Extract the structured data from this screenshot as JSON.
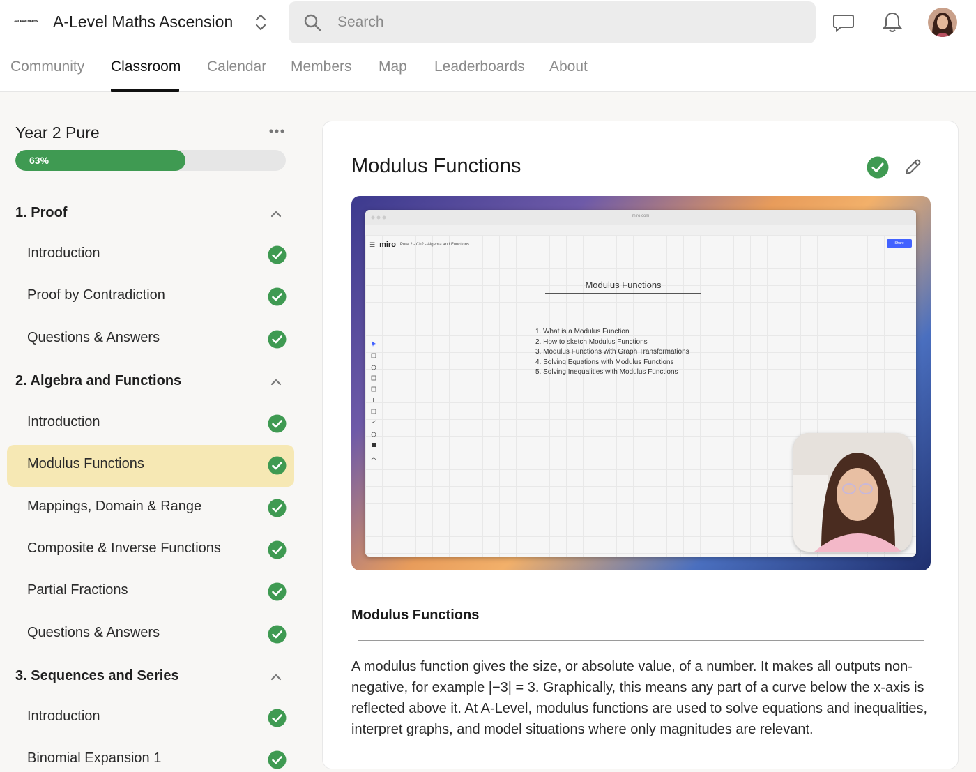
{
  "header": {
    "logo_text": "A-Level Maths",
    "title": "A-Level Maths Ascension",
    "search_placeholder": "Search"
  },
  "tabs": [
    {
      "label": "Community"
    },
    {
      "label": "Classroom"
    },
    {
      "label": "Calendar"
    },
    {
      "label": "Members"
    },
    {
      "label": "Map"
    },
    {
      "label": "Leaderboards"
    },
    {
      "label": "About"
    }
  ],
  "active_tab": "Classroom",
  "sidebar": {
    "course_title": "Year 2 Pure",
    "progress": {
      "value": 0.63,
      "label": "63%"
    },
    "sections": [
      {
        "title": "1. Proof",
        "expanded": true,
        "lessons": [
          {
            "label": "Introduction",
            "completed": true
          },
          {
            "label": "Proof by Contradiction",
            "completed": true
          },
          {
            "label": "Questions & Answers",
            "completed": true
          }
        ]
      },
      {
        "title": "2. Algebra and Functions",
        "expanded": true,
        "lessons": [
          {
            "label": "Introduction",
            "completed": true
          },
          {
            "label": "Modulus Functions",
            "completed": true,
            "active": true
          },
          {
            "label": "Mappings, Domain & Range",
            "completed": true
          },
          {
            "label": "Composite & Inverse Functions",
            "completed": true
          },
          {
            "label": "Partial Fractions",
            "completed": true
          },
          {
            "label": "Questions & Answers",
            "completed": true
          }
        ]
      },
      {
        "title": "3. Sequences and Series",
        "expanded": true,
        "lessons": [
          {
            "label": "Introduction",
            "completed": true
          },
          {
            "label": "Binomial Expansion 1",
            "completed": true
          }
        ]
      }
    ]
  },
  "main": {
    "title": "Modulus Functions",
    "completed": true,
    "video": {
      "browser_url": "miro.com",
      "app_name": "miro",
      "crumb": "Pure 2 - Ch2 - Algebra and Functions",
      "share_label": "Share",
      "board_title": "Modulus Functions",
      "board_items": [
        "1. What is a Modulus Function",
        "2. How to sketch Modulus Functions",
        "3. Modulus Functions with Graph Transformations",
        "4. Solving Equations with Modulus Functions",
        "5. Solving Inequalities with Modulus Functions"
      ]
    },
    "section_heading": "Modulus Functions",
    "description": "A modulus function gives the size, or absolute value, of a number. It makes all outputs non-negative, for example |−3| = 3. Graphically, this means any part of a curve below the x-axis is reflected above it. At A-Level, modulus functions are used to solve equations and inequalities, interpret graphs, and model situations where only magnitudes are relevant."
  },
  "colors": {
    "accent_green": "#3f9a52",
    "active_lesson_bg": "#f6e8b4"
  },
  "icons": [
    "search-icon",
    "chat-icon",
    "bell-icon",
    "chevron-up-icon",
    "check-circle-icon",
    "pencil-icon",
    "more-icon",
    "switcher-icon"
  ]
}
